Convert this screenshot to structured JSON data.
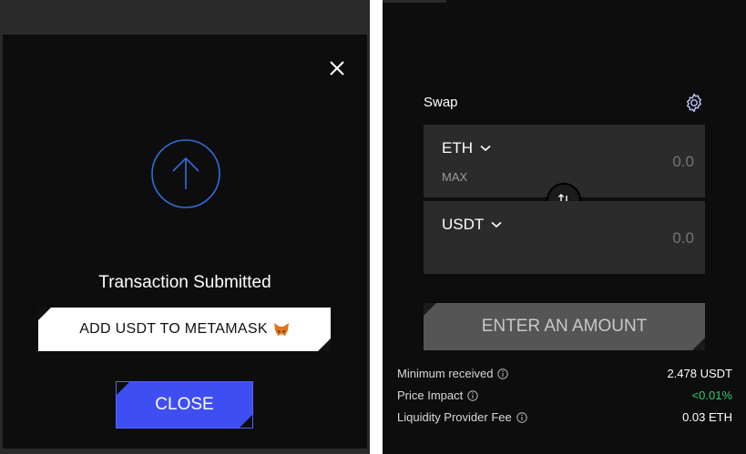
{
  "modal": {
    "title": "Transaction Submitted",
    "add_token_label": "ADD USDT TO METAMASK",
    "close_label": "CLOSE"
  },
  "swap": {
    "title": "Swap",
    "from": {
      "token": "ETH",
      "amount": "0.0",
      "max_label": "MAX"
    },
    "to": {
      "token": "USDT",
      "amount": "0.0"
    },
    "enter_amount_label": "ENTER AN AMOUNT",
    "details": {
      "min_received_label": "Minimum received",
      "min_received_value": "2.478 USDT",
      "price_impact_label": "Price Impact",
      "price_impact_value": "<0.01%",
      "lp_fee_label": "Liquidity Provider Fee",
      "lp_fee_value": "0.03 ETH"
    }
  },
  "colors": {
    "accent": "#3f4ef3",
    "status_ring": "#2f6fe0",
    "positive": "#2ecc71",
    "panel_bg": "#0d0d0d",
    "input_bg": "#2b2b2b"
  },
  "icons": [
    "close-icon",
    "arrow-up-icon",
    "metamask-fox-icon",
    "gear-icon",
    "chevron-down-icon",
    "swap-arrows-icon",
    "info-icon"
  ]
}
